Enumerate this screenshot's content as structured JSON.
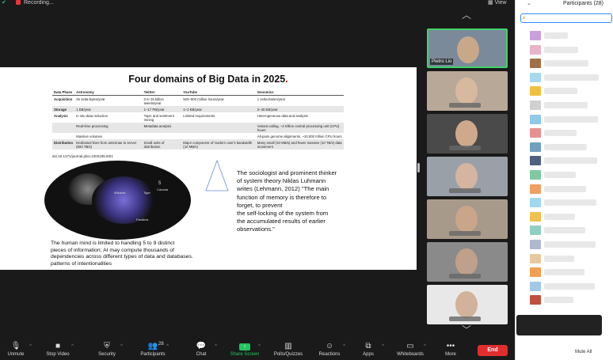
{
  "topbar": {
    "recording_label": "Recording...",
    "view_label": "View"
  },
  "slide": {
    "title_main": "Four domains of Big Data in 2025",
    "title_suffix": ".",
    "table": {
      "headers": [
        "Data Phase",
        "Astronomy",
        "Twitter",
        "YouTube",
        "Genomics"
      ],
      "rows": [
        [
          "Acquisition",
          "25 zetta-bytes/year",
          "0.5–15 billion tweets/year",
          "500–900 million hours/year",
          "1 zetta-bases/year"
        ],
        [
          "Storage",
          "1 EB/year",
          "1–17 PB/year",
          "1–2 EB/year",
          "2–40 EB/year"
        ],
        [
          "Analysis",
          "In situ data reduction",
          "Topic and sentiment mining",
          "Limited requirements",
          "Heterogeneous data and analysis"
        ],
        [
          "",
          "Real-time processing",
          "Metadata analysis",
          "",
          "Variant calling, ~2 trillion central processing unit (CPU) hours"
        ],
        [
          "",
          "Massive volumes",
          "",
          "",
          "All-pairs genome alignments, ~10,000 trillion CPU hours"
        ],
        [
          "Distribution",
          "Dedicated lines from antennae to server (600 TB/s)",
          "Small units of distribution",
          "Major component of modern user's bandwidth (10 MB/s)",
          "Many small (10 MB/s) and fewer massive (10 TB/s) data movement"
        ]
      ]
    },
    "doi": "doi:10.1371/journal.pbio.1002195.t001",
    "ellipse_labels": [
      "Wizards",
      "Tiger",
      "5",
      "Canada",
      "Parallels"
    ],
    "quote": "The sociologist and prominent thinker\nof system theory Niklas Luhmann\nwrites (Lehmann, 2012) \"The main\nfunction of memory is therefore to\nforget, to prevent\n the self-locking of the system from\nthe accumulated results of earlier\nobservations.\"",
    "bottom_text": "The human mind is limited to handling 5 to 9 distinct\npieces of information; AI may compute thousands of\ndependencies across different types of data and databases.\npatterns of intentionalities"
  },
  "gallery": {
    "tiles": [
      {
        "name": "Pietro Lio",
        "active": true,
        "bg": "#7a8a9a",
        "face": "#c9a88a"
      },
      {
        "name": "",
        "active": false,
        "bg": "#b8a898",
        "face": "#d7b9a0"
      },
      {
        "name": "",
        "active": false,
        "bg": "#4a4a4a",
        "face": "#cfa98c"
      },
      {
        "name": "",
        "active": false,
        "bg": "#9aa0a8",
        "face": "#d5b4a0"
      },
      {
        "name": "",
        "active": false,
        "bg": "#a89a8a",
        "face": "#c9a58a"
      },
      {
        "name": "",
        "active": false,
        "bg": "#8a8a8a",
        "face": "#bfa08a"
      },
      {
        "name": "",
        "active": false,
        "bg": "#e8e8e8",
        "face": "#d2b29a"
      }
    ]
  },
  "panel": {
    "title": "Participants (28)",
    "search_placeholder": "",
    "participants": [
      {
        "avatar": "#c9a0dc"
      },
      {
        "avatar": "#e8b4c8"
      },
      {
        "avatar": "#a0704a"
      },
      {
        "avatar": "#a8d8f0"
      },
      {
        "avatar": "#f0c040"
      },
      {
        "avatar": "#d0d0d0"
      },
      {
        "avatar": "#90c8e8"
      },
      {
        "avatar": "#e89090"
      },
      {
        "avatar": "#70a0c0"
      },
      {
        "avatar": "#506080"
      },
      {
        "avatar": "#80c8a0"
      },
      {
        "avatar": "#f0a060"
      },
      {
        "avatar": "#a0d8f0"
      },
      {
        "avatar": "#f0c050"
      },
      {
        "avatar": "#90d0c0"
      },
      {
        "avatar": "#b0b8d0"
      },
      {
        "avatar": "#e8c8a0"
      },
      {
        "avatar": "#f0a050"
      },
      {
        "avatar": "#a0c8e8"
      },
      {
        "avatar": "#c05040"
      }
    ],
    "mute_all": "Mute All",
    "invite_label": ""
  },
  "toolbar": {
    "buttons": [
      {
        "label": "Unmute",
        "icon": "🎙"
      },
      {
        "label": "Stop Video",
        "icon": "■"
      },
      {
        "label": "Security",
        "icon": "⛨"
      },
      {
        "label": "Participants",
        "icon": "👥",
        "count": "28"
      },
      {
        "label": "Chat",
        "icon": "💬"
      },
      {
        "label": "Share Screen",
        "icon": "↑"
      },
      {
        "label": "Polls/Quizzes",
        "icon": "▥"
      },
      {
        "label": "Reactions",
        "icon": "☺"
      },
      {
        "label": "Apps",
        "icon": "⧉"
      },
      {
        "label": "Whiteboards",
        "icon": "▭"
      },
      {
        "label": "More",
        "icon": "•••"
      }
    ],
    "end_label": "End"
  },
  "colors": {
    "share_green": "#22c55e",
    "end_red": "#e02e2e",
    "active_tile_border": "#3fd46c",
    "search_border": "#2d8cff"
  }
}
